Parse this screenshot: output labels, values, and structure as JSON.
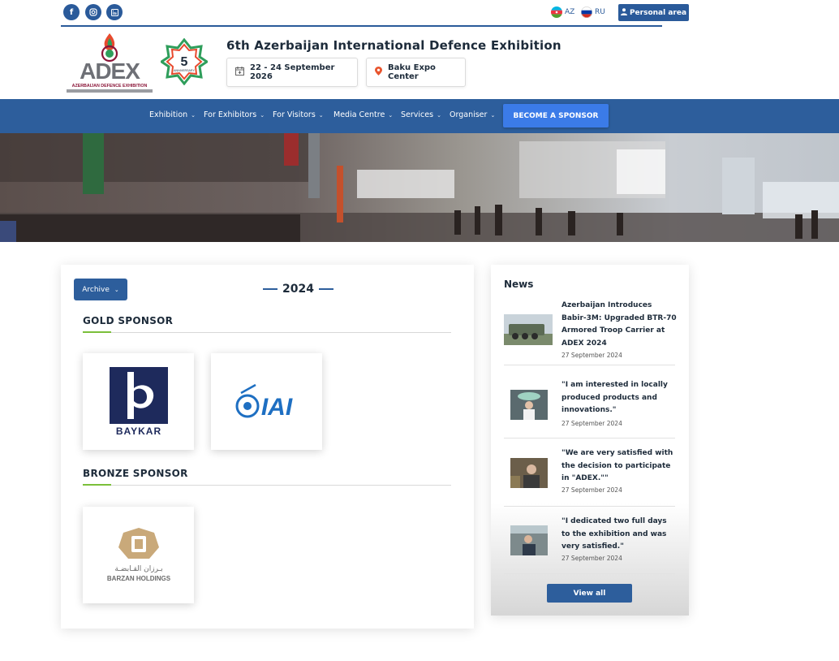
{
  "topbar": {
    "social": [
      {
        "name": "facebook-icon",
        "glyph": "f"
      },
      {
        "name": "instagram-icon",
        "glyph": "◎"
      },
      {
        "name": "linkedin-icon",
        "glyph": "in"
      }
    ],
    "lang_az": "AZ",
    "lang_ru": "RU",
    "personal_area": "Personal area"
  },
  "header": {
    "logo_text": "ADEX",
    "logo_subtext": "AZERBAIJAN DEFENCE EXHIBITION",
    "anniversary_number": "5",
    "anniversary_text": "ANNIVERSARY",
    "title": "6th Azerbaijan International Defence Exhibition",
    "dates": "22 - 24 September 2026",
    "venue": "Baku Expo Center"
  },
  "nav": {
    "items": [
      "Exhibition",
      "For Exhibitors",
      "For Visitors",
      "Media Centre",
      "Services",
      "Organiser"
    ],
    "cta": "BECOME A SPONSOR"
  },
  "sponsors": {
    "archive_label": "Archive",
    "year": "2024",
    "gold_title": "GOLD SPONSOR",
    "bronze_title": "BRONZE SPONSOR",
    "gold_logos": [
      "BAYKAR",
      "IAI"
    ],
    "bronze_logos": [
      "BARZAN HOLDINGS"
    ],
    "barzan_arabic": "بـرزان القـابضـة"
  },
  "news": {
    "heading": "News",
    "items": [
      {
        "title": "Azerbaijan Introduces Babir-3M: Upgraded BTR-70 Armored Troop Carrier at ADEX 2024",
        "date": "27 September 2024"
      },
      {
        "title": "\"I am interested in locally produced products and innovations.\"",
        "date": "27 September 2024"
      },
      {
        "title": "\"We are very satisfied with the decision to participate in \"ADEX.\"\"",
        "date": "27 September 2024"
      },
      {
        "title": "\"I dedicated two full days to the exhibition and was very satisfied.\"",
        "date": "27 September 2024"
      }
    ],
    "view_all": "View all"
  },
  "colors": {
    "brand_blue": "#2d5e9c",
    "cta_blue": "#3b7be8",
    "accent_green": "#7bbf3a"
  }
}
